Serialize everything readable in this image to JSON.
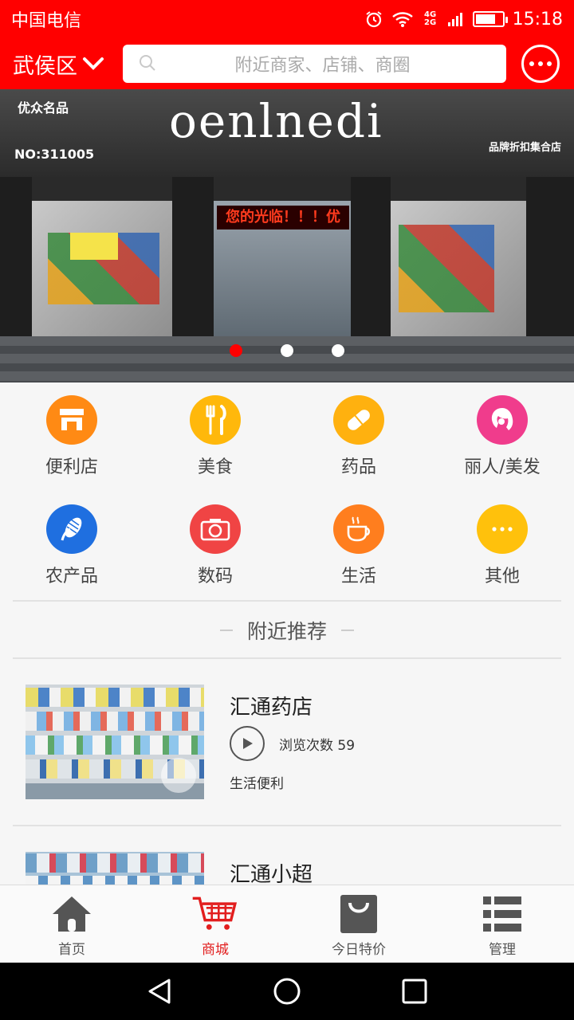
{
  "status_bar": {
    "carrier": "中国电信",
    "network": "4G 2G",
    "time": "15:18",
    "battery_level": 0.75
  },
  "header": {
    "location": "武侯区",
    "search_placeholder": "附近商家、店铺、商圈",
    "icons": [
      "chevron-down-icon",
      "search-icon",
      "chat-bubble-icon"
    ]
  },
  "banner": {
    "sign_left": "优众名品",
    "sign_logo": "oenlnedi",
    "sign_code": "NO:311005",
    "sign_right": "品牌折扣集合店",
    "led_text": "您的光临！！！优",
    "slide_count": 3,
    "active_slide": 1
  },
  "categories": [
    {
      "label": "便利店",
      "icon": "store-icon",
      "color": "#ff8a14"
    },
    {
      "label": "美食",
      "icon": "fork-knife-icon",
      "color": "#ffb80b"
    },
    {
      "label": "药品",
      "icon": "pill-icon",
      "color": "#ffb10f"
    },
    {
      "label": "丽人/美发",
      "icon": "woman-hair-icon",
      "color": "#f03c8c"
    },
    {
      "label": "农产品",
      "icon": "corn-icon",
      "color": "#1f6fe0"
    },
    {
      "label": "数码",
      "icon": "camera-icon",
      "color": "#f04444"
    },
    {
      "label": "生活",
      "icon": "coffee-cup-icon",
      "color": "#ff7e1e"
    },
    {
      "label": "其他",
      "icon": "more-dots-icon",
      "color": "#ffc10c"
    }
  ],
  "nearby": {
    "title": "附近推荐"
  },
  "shops": [
    {
      "name": "汇通药店",
      "views_label": "浏览次数 59",
      "tag": "生活便利"
    },
    {
      "name": "汇通小超",
      "views_label": "",
      "tag": ""
    }
  ],
  "tabs": [
    {
      "label": "首页",
      "icon": "home-icon",
      "active": false
    },
    {
      "label": "商城",
      "icon": "shopping-cart-icon",
      "active": true
    },
    {
      "label": "今日特价",
      "icon": "shopping-bag-icon",
      "active": false
    },
    {
      "label": "管理",
      "icon": "list-icon",
      "active": false
    }
  ],
  "colors": {
    "brand": "#ff0000",
    "active_tab": "#e21e1e",
    "inactive_icon": "#555555"
  }
}
